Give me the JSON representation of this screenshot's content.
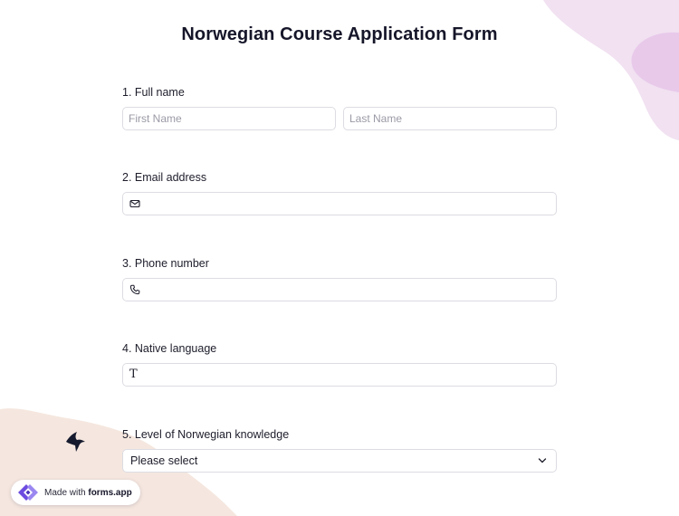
{
  "form": {
    "title": "Norwegian Course Application Form"
  },
  "questions": [
    {
      "label": "1.  Full name",
      "first_placeholder": "First Name",
      "last_placeholder": "Last Name"
    },
    {
      "label": "2. Email address",
      "icon": "envelope-icon"
    },
    {
      "label": "3. Phone number",
      "icon": "phone-icon"
    },
    {
      "label": "4. Native language",
      "icon": "text-icon",
      "icon_glyph": "T"
    },
    {
      "label": "5. Level of Norwegian knowledge",
      "selected": "Please select",
      "icon": "chevron-down-icon"
    }
  ],
  "badge": {
    "prefix": "Made with ",
    "brand": "forms.app",
    "icon": "forms-app-logo-icon"
  },
  "colors": {
    "blob_pink": "#f1e1f1",
    "blob_pink_dark": "#e8c9ea",
    "blob_beige": "#f5e7df",
    "field_border": "#dcdce3",
    "logo_purple": "#6c4ce0",
    "bird_dark": "#161a2e"
  }
}
